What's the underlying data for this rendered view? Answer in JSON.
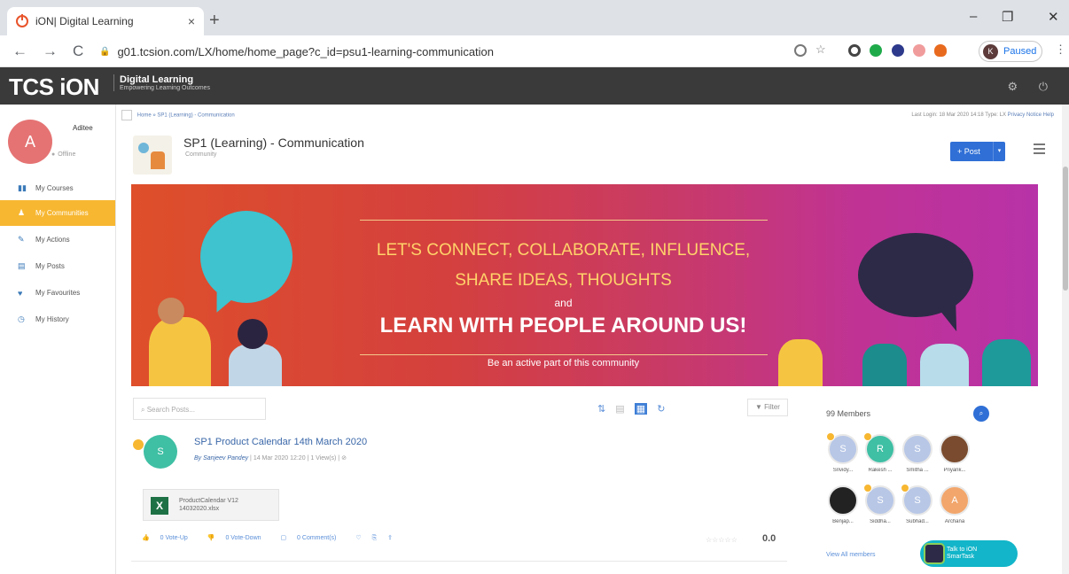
{
  "browser": {
    "tab_title": "iON| Digital Learning",
    "tab_close": "×",
    "new_tab": "+",
    "url": "g01.tcsion.com/LX/home/home_page?c_id=psu1-learning-communication",
    "profile_initial": "K",
    "profile_status": "Paused",
    "back": "←",
    "forward": "→",
    "reload": "C",
    "minimize": "–",
    "maximize": "❐",
    "close": "✕"
  },
  "app_header": {
    "logo": "TCS iON",
    "brand_title": "Digital Learning",
    "brand_tagline": "Empowering Learning Outcomes",
    "icons": "⚙ ⏻"
  },
  "user": {
    "initial": "A",
    "name": "Aditee",
    "status": "Offline"
  },
  "sidebar": {
    "items": [
      {
        "label": "My Courses",
        "icon": "▮▮",
        "active": false
      },
      {
        "label": "My Communities",
        "icon": "♟",
        "active": true
      },
      {
        "label": "My Actions",
        "icon": "✎",
        "active": false
      },
      {
        "label": "My Posts",
        "icon": "▤",
        "active": false
      },
      {
        "label": "My Favourites",
        "icon": "♥",
        "active": false
      },
      {
        "label": "My History",
        "icon": "◷",
        "active": false
      }
    ]
  },
  "breadcrumb": {
    "path": "Home » SP1 (Learning) - Communication",
    "last_login": "Last Login: 18 Mar 2020 14:18 Type: LX",
    "privacy": "Privacy Notice",
    "help": "Help"
  },
  "community": {
    "title": "SP1 (Learning) - Communication",
    "subtitle": "Community",
    "post_button": "+ Post",
    "post_caret": "▾"
  },
  "banner": {
    "line1": "LET'S CONNECT, COLLABORATE, INFLUENCE,",
    "line2": "SHARE IDEAS, THOUGHTS",
    "line3": "and",
    "line4": "LEARN WITH PEOPLE AROUND US!",
    "line5": "Be an active part of this community"
  },
  "feed": {
    "search_placeholder": "Search Posts...",
    "filter_label": "▼ Filter",
    "view_icons": [
      "⇅",
      "▤",
      "▦",
      "↻"
    ],
    "post": {
      "avatar_initial": "S",
      "title": "SP1 Product Calendar 14th March 2020",
      "author": "By Sanjeev Pandey",
      "date": "14 Mar 2020 12:20",
      "views": "1 View(s)",
      "link_icon": "⊘",
      "attachment_name": "ProductCalendar V12 14032020.xlsx",
      "attachment_icon": "X",
      "vote_up": "0 Vote-Up",
      "vote_down": "0 Vote-Down",
      "comments": "0 Comment(s)",
      "stars": "☆☆☆☆☆",
      "rating": "0.0"
    }
  },
  "members": {
    "title": "99 Members",
    "search_icon": "🔍",
    "list": [
      {
        "initial": "S",
        "name": "Srividy...",
        "color": "#b8c7e6",
        "badge": true
      },
      {
        "initial": "R",
        "name": "Rakesh ...",
        "color": "#3fbfa4",
        "badge": true
      },
      {
        "initial": "S",
        "name": "Smitha ...",
        "color": "#b8c7e6",
        "badge": false
      },
      {
        "initial": "",
        "name": "Priyank...",
        "color": "#7a4b2e",
        "badge": false
      },
      {
        "initial": "",
        "name": "Benjap...",
        "color": "#222222",
        "badge": false
      },
      {
        "initial": "S",
        "name": "Siddha...",
        "color": "#b8c7e6",
        "badge": true
      },
      {
        "initial": "S",
        "name": "Subhad...",
        "color": "#b8c7e6",
        "badge": true
      },
      {
        "initial": "A",
        "name": "Archana",
        "color": "#f2a66b",
        "badge": false
      }
    ],
    "view_all": "View All members",
    "talk_line1": "Talk to iON",
    "talk_line2": "SmarTask"
  },
  "colors": {
    "accent": "#2f6fd6",
    "sidebar_active": "#f7b731",
    "header_bg": "#3a3a3a"
  }
}
